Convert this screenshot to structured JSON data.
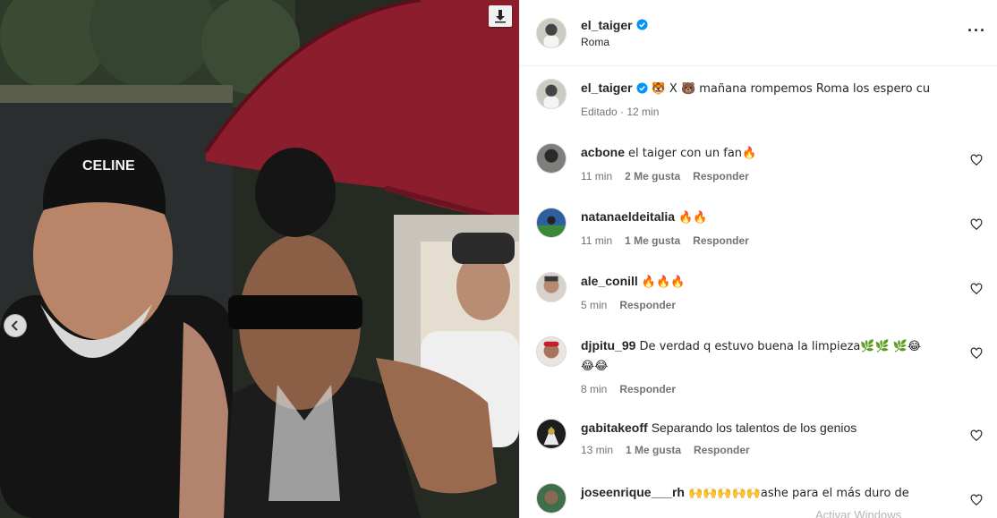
{
  "post": {
    "author": "el_taiger",
    "location": "Roma",
    "caption_text": "🐯 X 🐻 mañana rompemos Roma los espero cu",
    "caption_meta": "Editado · 12 min"
  },
  "icons": {
    "download": "download-arrow-icon",
    "prev": "chevron-left-icon",
    "more": "more-options-icon",
    "verified": "verified-badge-icon",
    "like": "heart-outline-icon"
  },
  "colors": {
    "verified_blue": "#0095f6",
    "umbrella_red": "#8c1d2c"
  },
  "comments": [
    {
      "user": "acbone",
      "text": "el taiger con un fan🔥",
      "time": "11 min",
      "likes": "2 Me gusta",
      "reply": "Responder"
    },
    {
      "user": "natanaeldeitalia",
      "text": "🔥🔥",
      "time": "11 min",
      "likes": "1 Me gusta",
      "reply": "Responder"
    },
    {
      "user": "ale_conill",
      "text": "🔥🔥🔥",
      "time": "5 min",
      "likes": "",
      "reply": "Responder"
    },
    {
      "user": "djpitu_99",
      "text": "De verdad q estuvo buena la limpieza🌿🌿 🌿😂",
      "text2": "😂😂",
      "time": "8 min",
      "likes": "",
      "reply": "Responder"
    },
    {
      "user": "gabitakeoff",
      "text": "Separando los talentos de los genios",
      "time": "13 min",
      "likes": "1 Me gusta",
      "reply": "Responder"
    },
    {
      "user": "joseenrique___rh",
      "text": "🙌🙌🙌🙌🙌ashe para el más duro de",
      "time": "",
      "likes": "",
      "reply": ""
    }
  ],
  "watermark": "Activar Windows"
}
